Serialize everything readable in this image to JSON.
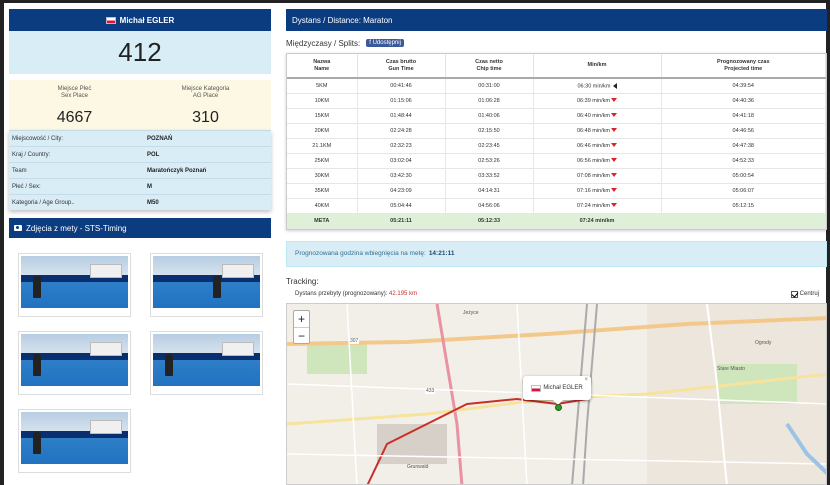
{
  "runner": {
    "name": "Michał EGLER",
    "bib": "412",
    "sex_place_label_1": "Miejsce Płeć",
    "sex_place_label_2": "Sex Place",
    "sex_place": "4667",
    "age_place_label_1": "Miejsce Kategoria",
    "age_place_label_2": "AG Place",
    "age_place": "310"
  },
  "info_rows": [
    {
      "label": "Miejscowość / City:",
      "value": "POZNAŃ"
    },
    {
      "label": "Kraj / Country:",
      "value": "POL"
    },
    {
      "label": "Team",
      "value": "Maratończyk Poznań"
    },
    {
      "label": "Płeć / Sex:",
      "value": "M"
    },
    {
      "label": "Kategoria / Age Group..",
      "value": "M50"
    }
  ],
  "photos": {
    "title": "Zdjęcia z mety - STS-Timing",
    "count": 5
  },
  "distance_header": "Dystans / Distance: Maraton",
  "splits": {
    "title": "Międzyczasy / Splits:",
    "fb_button": "f Udostępnij",
    "headers": [
      [
        "Nazwa",
        "Name"
      ],
      [
        "Czas brutto",
        "Gun Time"
      ],
      [
        "Czas netto",
        "Chip time"
      ],
      [
        "Min/km",
        ""
      ],
      [
        "Prognozowany czas",
        "Projected time"
      ]
    ],
    "rows": [
      {
        "name": "5KM",
        "gun": "00:41:46",
        "chip": "00:31:00",
        "pace": "06:30 min/km",
        "trend": "left",
        "proj": "04:39:54"
      },
      {
        "name": "10KM",
        "gun": "01:15:06",
        "chip": "01:06:28",
        "pace": "06:39 min/km",
        "trend": "down",
        "proj": "04:40:36"
      },
      {
        "name": "15KM",
        "gun": "01:48:44",
        "chip": "01:40:06",
        "pace": "06:40 min/km",
        "trend": "down",
        "proj": "04:41:18"
      },
      {
        "name": "20KM",
        "gun": "02:24:28",
        "chip": "02:15:50",
        "pace": "06:48 min/km",
        "trend": "down",
        "proj": "04:46:56"
      },
      {
        "name": "21.1KM",
        "gun": "02:32:23",
        "chip": "02:23:45",
        "pace": "06:46 min/km",
        "trend": "down",
        "proj": "04:47:38"
      },
      {
        "name": "25KM",
        "gun": "03:02:04",
        "chip": "02:53:26",
        "pace": "06:56 min/km",
        "trend": "down",
        "proj": "04:52:33"
      },
      {
        "name": "30KM",
        "gun": "03:42:30",
        "chip": "03:33:52",
        "pace": "07:08 min/km",
        "trend": "down",
        "proj": "05:00:54"
      },
      {
        "name": "35KM",
        "gun": "04:23:09",
        "chip": "04:14:31",
        "pace": "07:16 min/km",
        "trend": "down",
        "proj": "05:06:07"
      },
      {
        "name": "40KM",
        "gun": "05:04:44",
        "chip": "04:56:06",
        "pace": "07:24 min/km",
        "trend": "down",
        "proj": "05:12:15"
      }
    ],
    "finish": {
      "name": "META",
      "gun": "05:21:11",
      "chip": "05:12:33",
      "pace": "07:24 min/km",
      "proj": ""
    }
  },
  "prediction": {
    "text": "Prognozowana godzina wbiegnięcia na metę:",
    "time": "14:21:11"
  },
  "tracking": {
    "title": "Tracking:",
    "distance_label": "Dystans przebyty (prognozowany):",
    "distance_value": "42.195 km",
    "follow_label": "Centruj",
    "zoom_in": "+",
    "zoom_out": "−",
    "popup_name": "Michał EGLER",
    "close": "×"
  },
  "map_labels": [
    "Stare Miasto",
    "Ogrody",
    "307",
    "433",
    "Jeżyce",
    "Grunwald"
  ],
  "colors": {
    "header_blue": "#0c3c80",
    "info_blue": "#d9edf7",
    "place_yellow": "#fcf8e3",
    "finish_green": "#dff0d8",
    "trend_red": "#d9232d"
  }
}
